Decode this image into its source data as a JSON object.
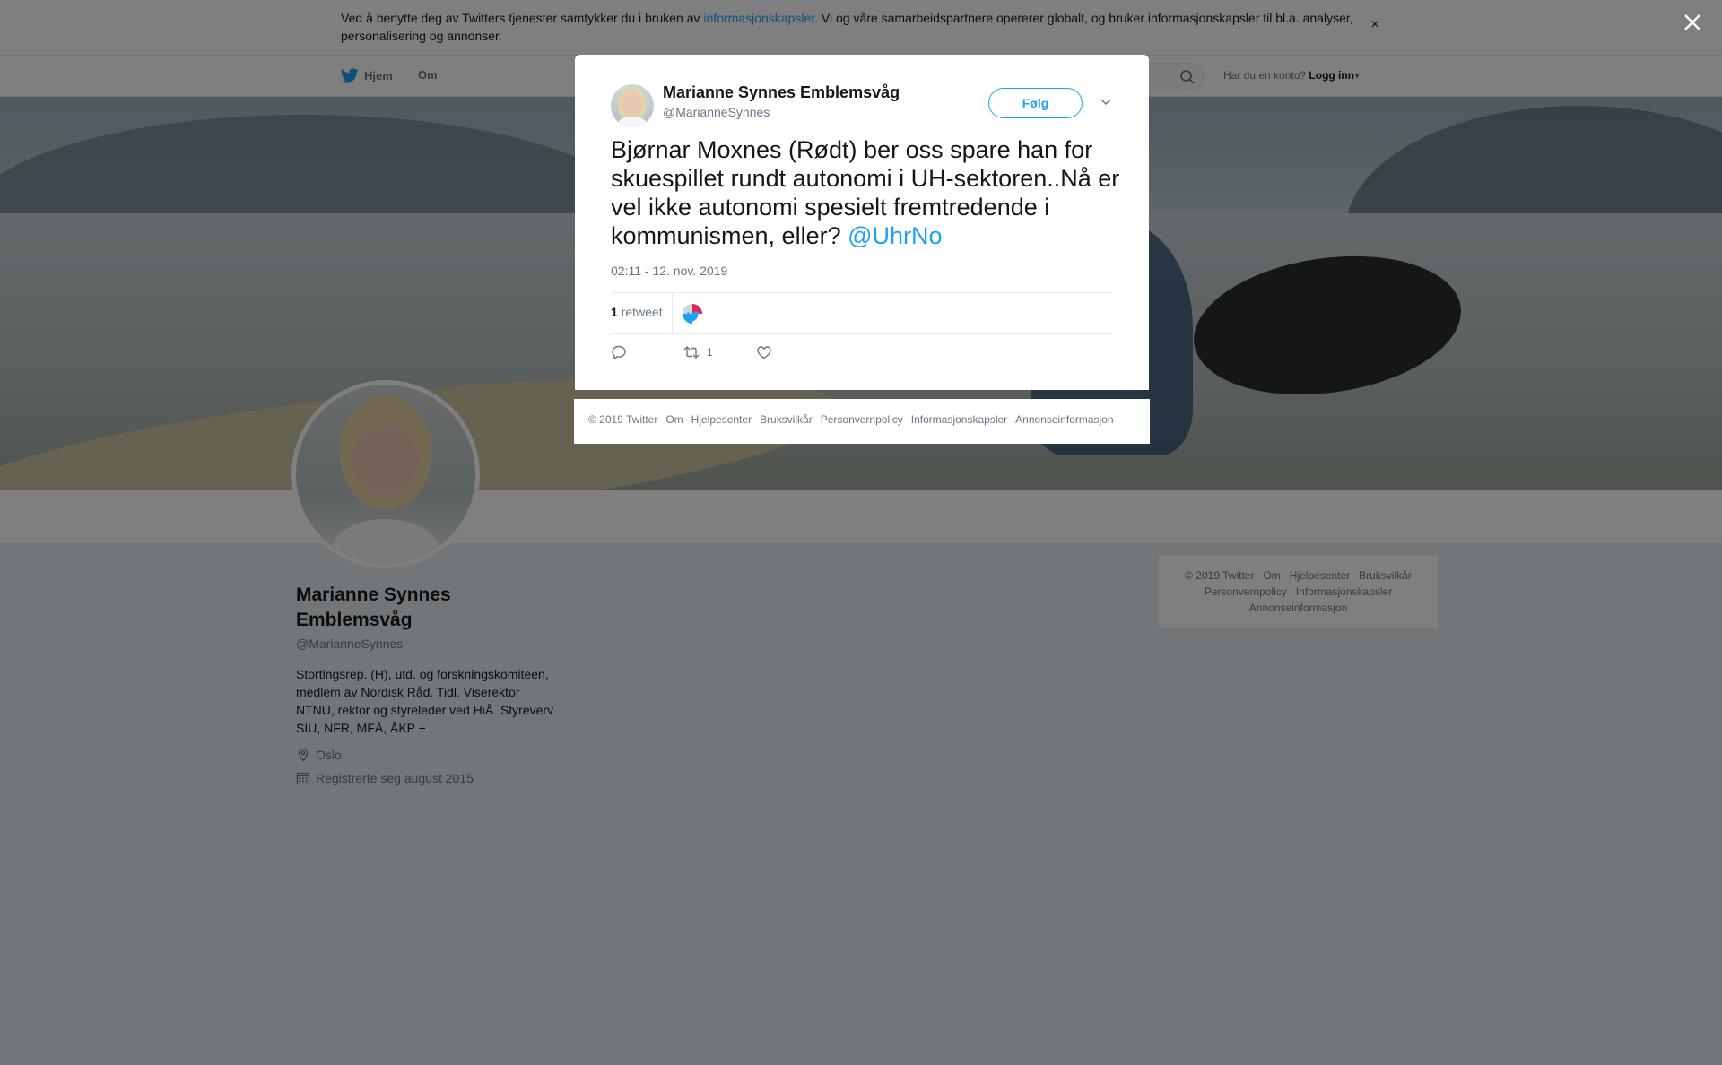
{
  "cookie_banner": {
    "text_before": "Ved å benytte deg av Twitters tjenester samtykker du i bruken av ",
    "link": "informasjonskapsler",
    "text_after": ". Vi og våre samarbeidspartnere opererer globalt, og bruker informasjonskapsler til bl.a. analyser, personalisering og annonser.",
    "close": "×"
  },
  "nav": {
    "home": "Hjem",
    "about": "Om",
    "login_prompt": "Har du en konto?",
    "login": "Logg inn"
  },
  "profile": {
    "name": "Marianne Synnes Emblemsvåg",
    "handle": "@MarianneSynnes",
    "bio": "Stortingsrep. (H), utd. og forskningskomiteen, medlem av Nordisk Råd. Tidl. Viserektor NTNU, rektor og styreleder ved HiÅ. Styreverv SIU, NFR, MFÅ, ÅKP +",
    "location": "Oslo",
    "joined": "Registrerte seg august 2015"
  },
  "side_footer": {
    "links": [
      "© 2019 Twitter",
      "Om",
      "Hjelpesenter",
      "Bruksvilkår",
      "Personvernpolicy",
      "Informasjonskapsler",
      "Annonseinformasjon"
    ]
  },
  "tweet": {
    "name": "Marianne Synnes Emblemsvåg",
    "handle": "@MarianneSynnes",
    "follow": "Følg",
    "text": "Bjørnar Moxnes (Rødt) ber oss spare han for skuespillet rundt autonomi i UH-sektoren..Nå er vel ikke autonomi spesielt fremtredende i kommunismen, eller? ",
    "mention": "@UhrNo",
    "time": "02:11 - 12. nov. 2019",
    "retweet_count": "1",
    "retweet_label": " retweet",
    "retweet_action_count": "1"
  },
  "modal_footer": {
    "links": [
      "© 2019 Twitter",
      "Om",
      "Hjelpesenter",
      "Bruksvilkår",
      "Personvernpolicy",
      "Informasjonskapsler",
      "Annonseinformasjon"
    ]
  },
  "colors": {
    "accent": "#1da1f2",
    "text": "#14171a",
    "muted": "#657786"
  }
}
